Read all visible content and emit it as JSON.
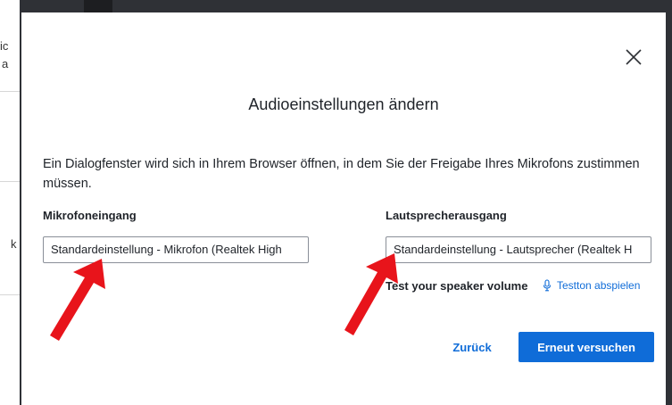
{
  "dialog": {
    "title": "Audioeinstellungen ändern",
    "description": "Ein Dialogfenster wird sich in Ihrem Browser öffnen, in dem Sie der Freigabe Ihres Mikrofons zustimmen müssen.",
    "close_icon": "close-icon"
  },
  "microphone": {
    "label": "Mikrofoneingang",
    "selected": "Standardeinstellung - Mikrofon (Realtek High"
  },
  "speaker": {
    "label": "Lautsprecherausgang",
    "selected": "Standardeinstellung - Lautsprecher (Realtek H",
    "test_label": "Test your speaker volume",
    "test_icon": "microphone-icon",
    "test_link": "Testton abspielen"
  },
  "actions": {
    "back_label": "Zurück",
    "retry_label": "Erneut versuchen"
  },
  "background": {
    "fragments": [
      "ic",
      "a",
      "k"
    ]
  },
  "colors": {
    "accent": "#0f6cd8",
    "annotation_arrow": "#e8141b",
    "backdrop_dark": "#2f3136"
  }
}
